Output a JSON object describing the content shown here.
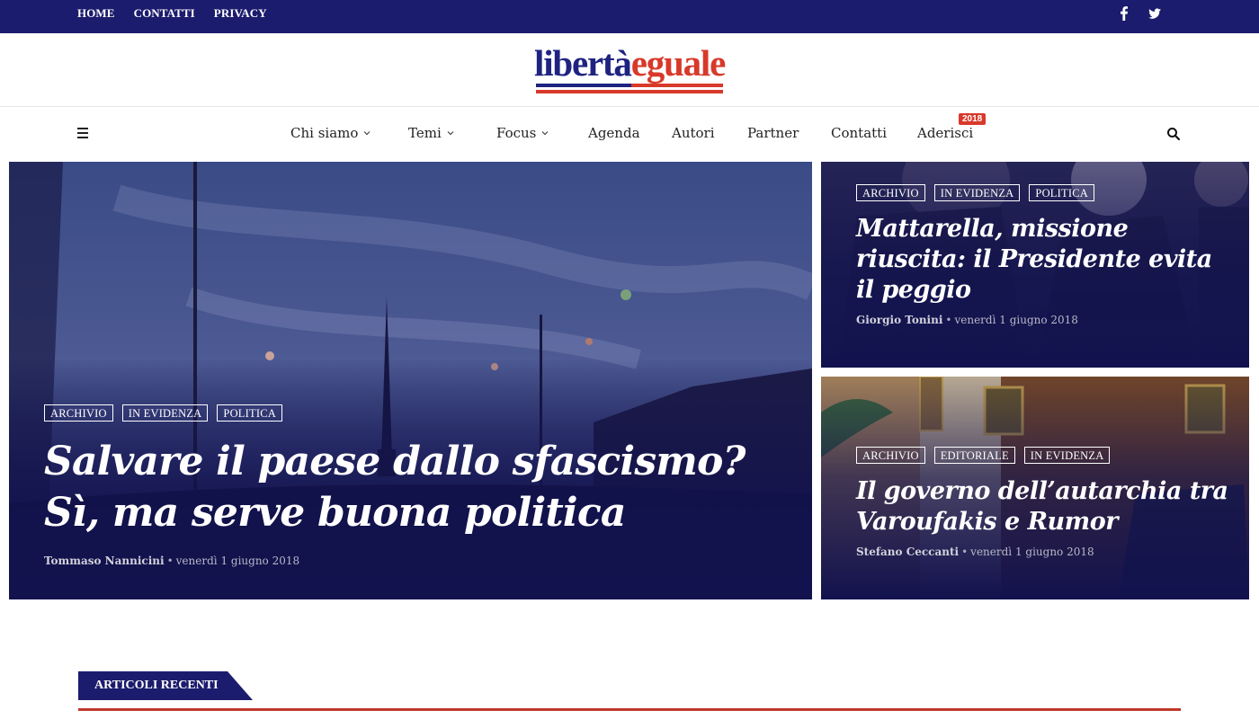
{
  "topbar": {
    "links": [
      "HOME",
      "CONTATTI",
      "PRIVACY"
    ],
    "social": [
      "facebook-icon",
      "twitter-icon"
    ]
  },
  "brand": {
    "name_part1": "libertà",
    "name_part2": "eguale",
    "colors": {
      "blue": "#1f2380",
      "red": "#d8392a"
    }
  },
  "nav": {
    "items": [
      {
        "label": "Chi siamo",
        "dropdown": true
      },
      {
        "label": "Temi",
        "dropdown": true
      },
      {
        "label": "Focus",
        "dropdown": true
      },
      {
        "label": "Agenda",
        "dropdown": false
      },
      {
        "label": "Autori",
        "dropdown": false
      },
      {
        "label": "Partner",
        "dropdown": false
      },
      {
        "label": "Contatti",
        "dropdown": false
      },
      {
        "label": "Aderisci",
        "dropdown": false
      }
    ],
    "badge": "2018"
  },
  "hero": {
    "main": {
      "tags": [
        "ARCHIVIO",
        "IN EVIDENZA",
        "POLITICA"
      ],
      "title": "Salvare il paese dallo sfascismo? Sì, ma serve buona politica",
      "author": "Tommaso Nannicini",
      "date": "venerdì 1 giugno 2018"
    },
    "side1": {
      "tags": [
        "ARCHIVIO",
        "IN EVIDENZA",
        "POLITICA"
      ],
      "title": "Mattarella, missione riuscita: il Presidente evita il peggio",
      "author": "Giorgio Tonini",
      "date": "venerdì 1 giugno 2018"
    },
    "side2": {
      "tags": [
        "ARCHIVIO",
        "EDITORIALE",
        "IN EVIDENZA"
      ],
      "title": "Il governo dell’autarchia tra Varoufakis e Rumor",
      "author": "Stefano Ceccanti",
      "date": "venerdì 1 giugno 2018"
    }
  },
  "sections": {
    "recent_title": "ARTICOLI RECENTI"
  },
  "colors": {
    "topbar": "#1c1c6e",
    "overlay": "#12124e",
    "accent_red": "#c0392b"
  }
}
